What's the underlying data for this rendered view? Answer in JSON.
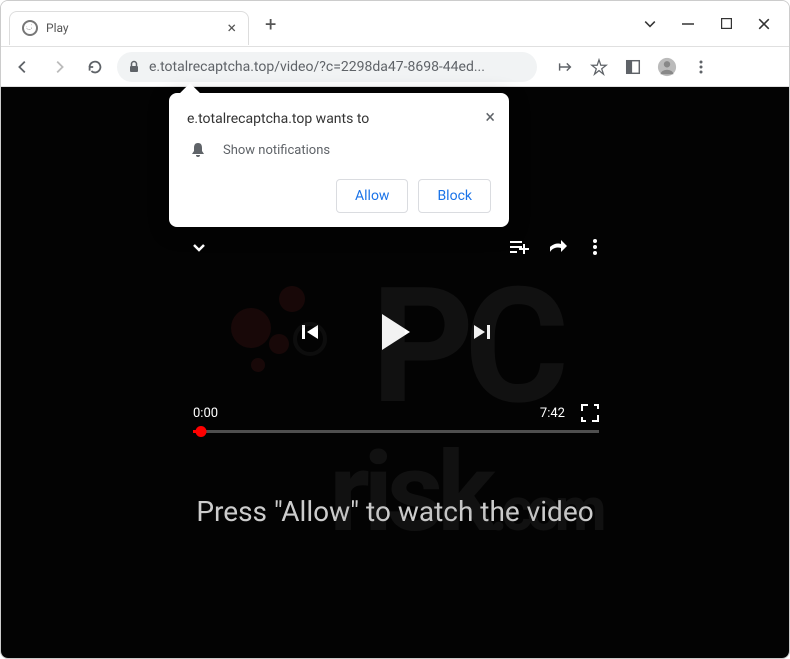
{
  "window": {
    "tab_title": "Play",
    "url": "e.totalrecaptcha.top/video/?c=2298da47-8698-44ed..."
  },
  "notification": {
    "host_wants": "e.totalrecaptcha.top wants to",
    "permission": "Show notifications",
    "allow": "Allow",
    "block": "Block"
  },
  "player": {
    "current_time": "0:00",
    "duration": "7:42"
  },
  "page": {
    "prompt": "Press \"Allow\" to watch the video"
  },
  "watermark": {
    "line1": "PC",
    "line2": "risk",
    "tld": ".com"
  }
}
